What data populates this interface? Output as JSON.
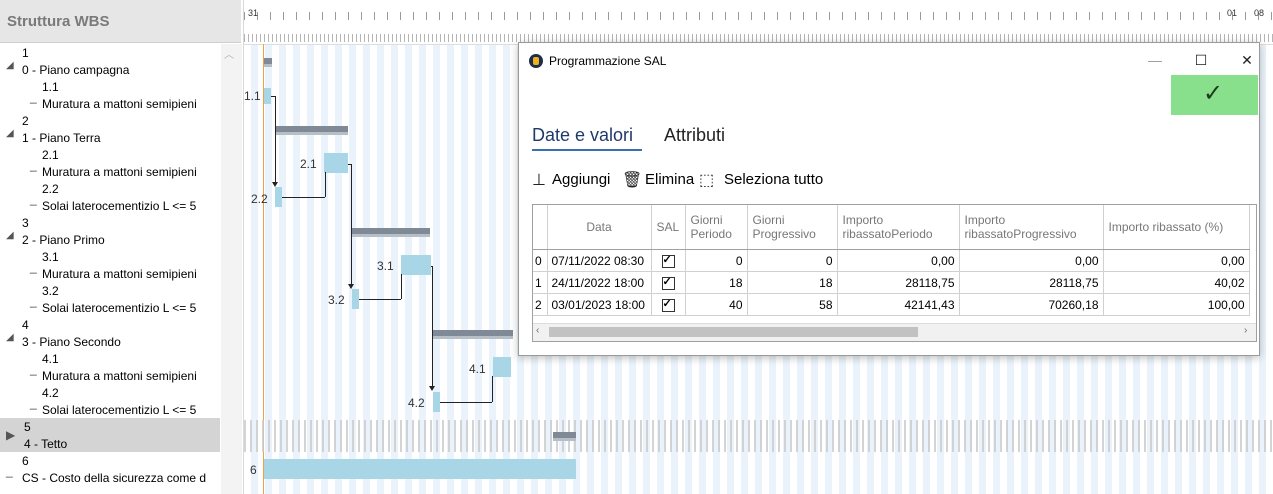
{
  "wbs": {
    "title": "Struttura WBS",
    "nodes": [
      {
        "num": "1",
        "name": "0 - Piano campagna"
      },
      {
        "num": "1.1",
        "name": "Muratura a mattoni semipieni"
      },
      {
        "num": "2",
        "name": "1 - Piano Terra"
      },
      {
        "num": "2.1",
        "name": "Muratura a mattoni semipieni"
      },
      {
        "num": "2.2",
        "name": "Solai laterocementizio L <= 5"
      },
      {
        "num": "3",
        "name": "2 - Piano Primo"
      },
      {
        "num": "3.1",
        "name": "Muratura a mattoni semipieni"
      },
      {
        "num": "3.2",
        "name": "Solai laterocementizio L <= 5"
      },
      {
        "num": "4",
        "name": "3 - Piano Secondo"
      },
      {
        "num": "4.1",
        "name": "Muratura a mattoni semipieni"
      },
      {
        "num": "4.2",
        "name": "Solai laterocementizio L <= 5"
      },
      {
        "num": "5",
        "name": "4 - Tetto"
      },
      {
        "num": "6",
        "name": "CS - Costo della sicurezza come d"
      }
    ]
  },
  "gantt": {
    "timescale": {
      "start": "31",
      "mid": "01",
      "end": "08"
    },
    "labels": {
      "t11": "1.1",
      "t21": "2.1",
      "t22": "2.2",
      "t31": "3.1",
      "t32": "3.2",
      "t41": "4.1",
      "t42": "4.2",
      "t6": "6"
    }
  },
  "dialog": {
    "title": "Programmazione SAL",
    "tabs": {
      "dates": "Date e valori",
      "attributes": "Attributi"
    },
    "toolbar": {
      "add": "Aggiungi",
      "delete": "Elimina",
      "select_all": "Seleziona  tutto"
    },
    "columns": {
      "data": "Data",
      "sal": "SAL",
      "giorni_periodo": "Giorni Periodo",
      "giorni_progressivo": "Giorni Progressivo",
      "importo_periodo": "Importo ribassatoPeriodo",
      "importo_progressivo": "Importo ribassatoProgressivo",
      "importo_pct": "Importo ribassato (%)"
    },
    "rows": [
      {
        "idx": "0",
        "data": "07/11/2022 08:30",
        "sal": true,
        "gp": "0",
        "gprog": "0",
        "ip": "0,00",
        "iprog": "0,00",
        "pct": "0,00"
      },
      {
        "idx": "1",
        "data": "24/11/2022 18:00",
        "sal": true,
        "gp": "18",
        "gprog": "18",
        "ip": "28118,75",
        "iprog": "28118,75",
        "pct": "40,02"
      },
      {
        "idx": "2",
        "data": "03/01/2023 18:00",
        "sal": true,
        "gp": "40",
        "gprog": "58",
        "ip": "42141,43",
        "iprog": "70260,18",
        "pct": "100,00"
      }
    ]
  },
  "colors": {
    "confirm": "#88e08c",
    "task": "#a8d6e6",
    "summary": "#7f8a96",
    "today": "#f0a040"
  }
}
